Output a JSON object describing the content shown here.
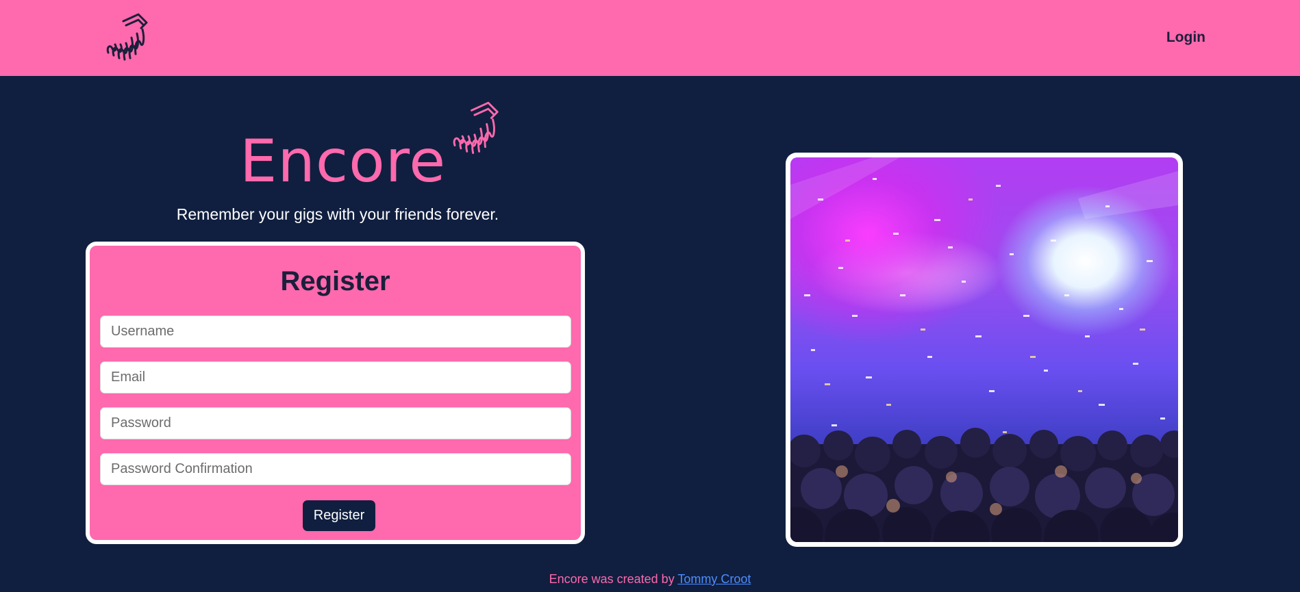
{
  "nav": {
    "login_label": "Login"
  },
  "brand": {
    "name": "Encore",
    "tagline": "Remember your gigs with your friends forever."
  },
  "register_form": {
    "title": "Register",
    "username_placeholder": "Username",
    "email_placeholder": "Email",
    "password_placeholder": "Password",
    "password_confirmation_placeholder": "Password Confirmation",
    "submit_label": "Register"
  },
  "footer": {
    "text": "Encore was created by ",
    "author_link": "Tommy Croot"
  },
  "colors": {
    "brand_pink": "#ff69ad",
    "background_navy": "#101f3f",
    "link_blue": "#4d8dff"
  },
  "icons": {
    "nav_logo": "music-hand-icon",
    "brand_logo": "music-hand-icon"
  },
  "hero_image": {
    "subject": "concert crowd with confetti and stage lights"
  }
}
